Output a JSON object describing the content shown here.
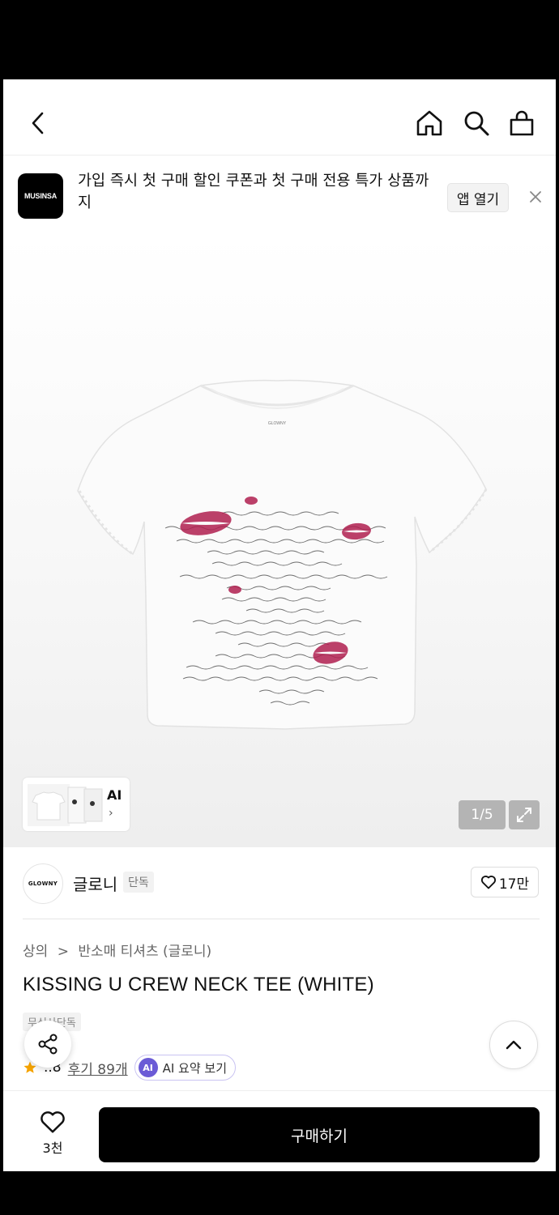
{
  "header": {
    "back_icon": "chevron-left-icon",
    "home_icon": "home-icon",
    "search_icon": "search-icon",
    "cart_icon": "shopping-bag-icon"
  },
  "banner": {
    "logo_text": "MUSINSA",
    "message": "가입 즉시 첫 구매 할인 쿠폰과 첫 구매 전용 특가 상품까지",
    "open_app_label": "앱 열기",
    "close_icon": "close-icon"
  },
  "gallery": {
    "thumb_label": "AI",
    "page_counter": "1/5",
    "expand_icon": "expand-icon",
    "tee_brand_label": "GLOWNY"
  },
  "brand": {
    "logo_text": "GLOWNY",
    "name": "글로니",
    "tag": "단독",
    "like_count": "17만"
  },
  "product": {
    "breadcrumb": [
      "상의",
      ">",
      "반소매 티셔츠 (글로니)"
    ],
    "title": "KISSING U CREW NECK TEE (WHITE)",
    "exclusive_tag": "무신사단독",
    "rating_partial": "..8",
    "review_label": "후기 89개",
    "ai_badge": "AI",
    "ai_summary_label": "AI 요약 보기"
  },
  "bottom": {
    "wish_count": "3천",
    "buy_label": "구매하기"
  },
  "colors": {
    "accent_purple": "#6b5bd6",
    "star": "#f5a300",
    "buy_button": "#000000"
  }
}
